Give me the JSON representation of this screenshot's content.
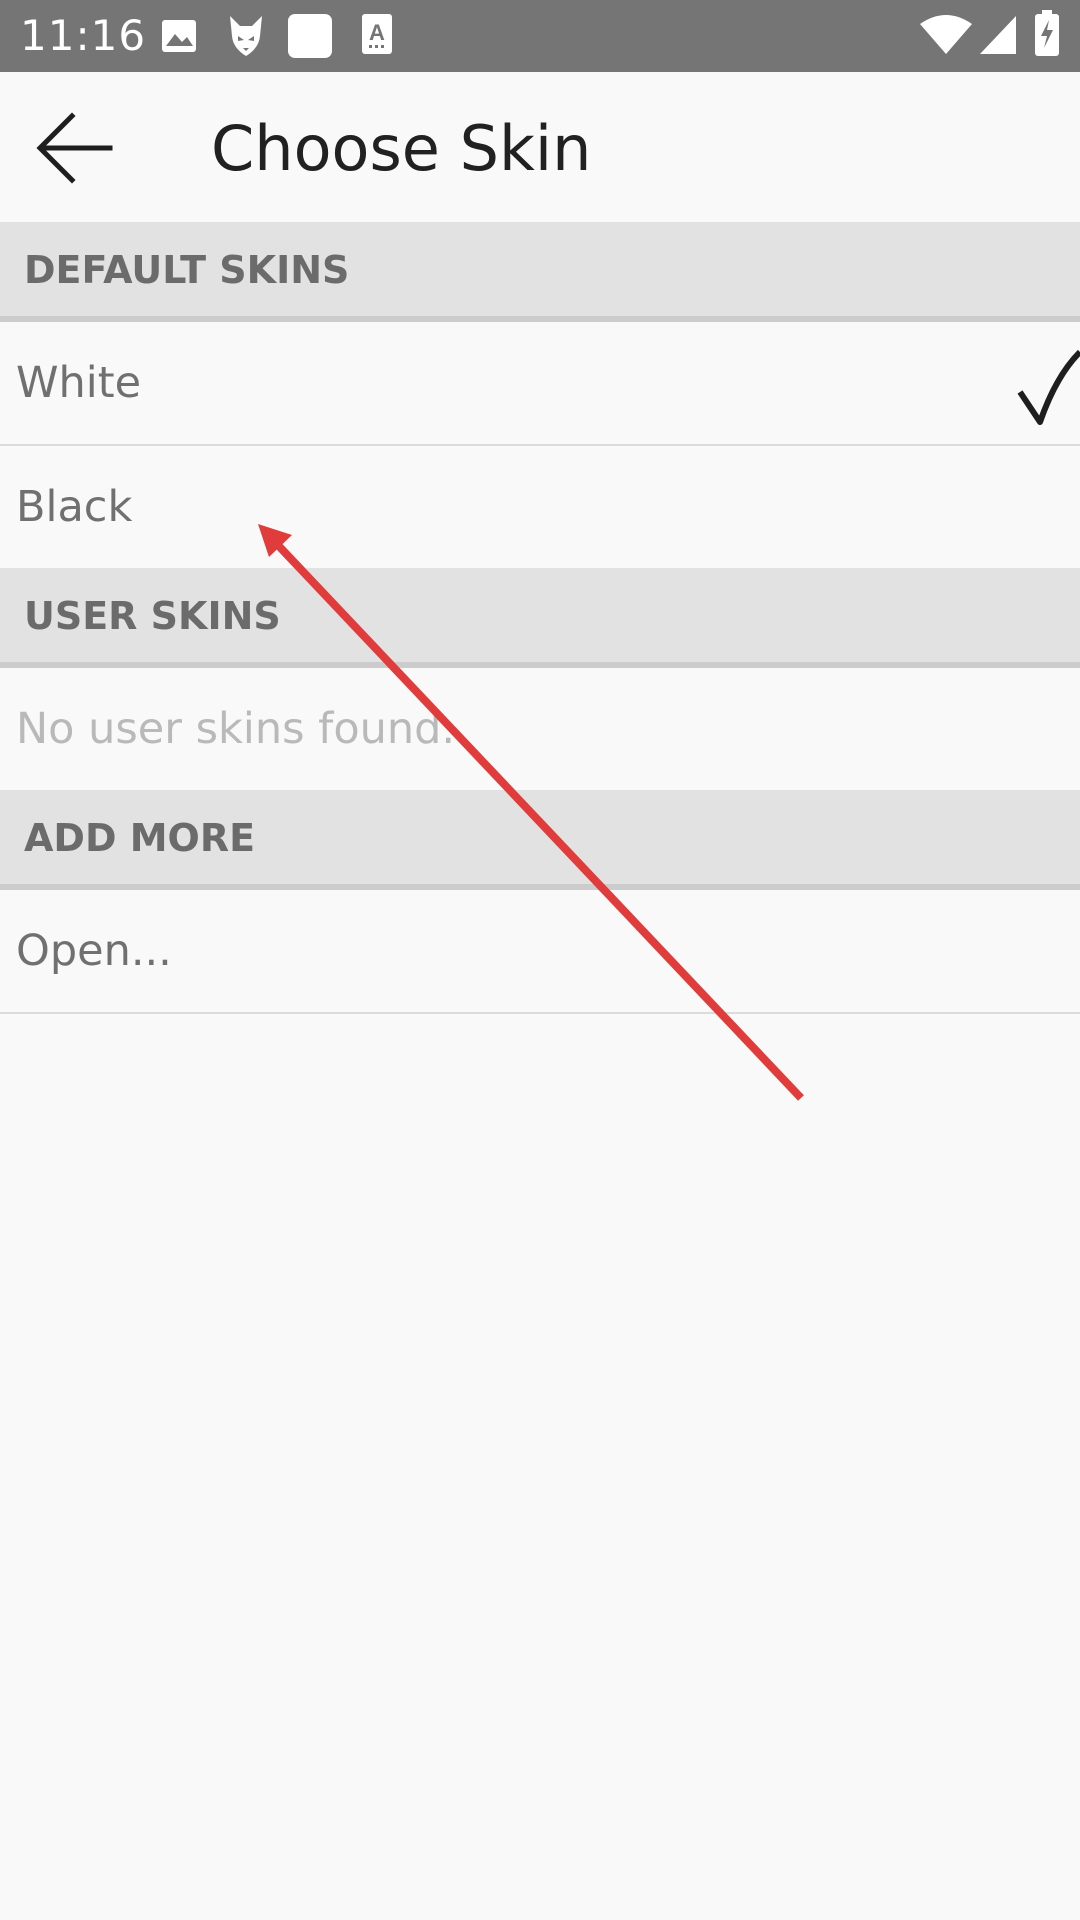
{
  "status_bar": {
    "time": "11:16",
    "left_icons": [
      "image-icon",
      "fox-icon",
      "square-icon",
      "text-a-icon"
    ],
    "right_icons": [
      "wifi-icon",
      "signal-icon",
      "battery-charging-icon"
    ]
  },
  "app_bar": {
    "back_icon": "arrow-left-icon",
    "title": "Choose Skin"
  },
  "sections": {
    "default_skins": {
      "header": "DEFAULT SKINS",
      "items": [
        {
          "label": "White",
          "selected": true
        },
        {
          "label": "Black",
          "selected": false
        }
      ]
    },
    "user_skins": {
      "header": "USER SKINS",
      "empty_text": "No user skins found."
    },
    "add_more": {
      "header": "ADD MORE",
      "items": [
        {
          "label": "Open..."
        }
      ]
    }
  },
  "colors": {
    "status_bar": "#757575",
    "section_header_bg": "#e2e2e2",
    "section_header_text": "#6b6b6b",
    "item_text": "#707070",
    "muted_text": "#b9b9b9",
    "annotation_arrow": "#e03c3c"
  }
}
